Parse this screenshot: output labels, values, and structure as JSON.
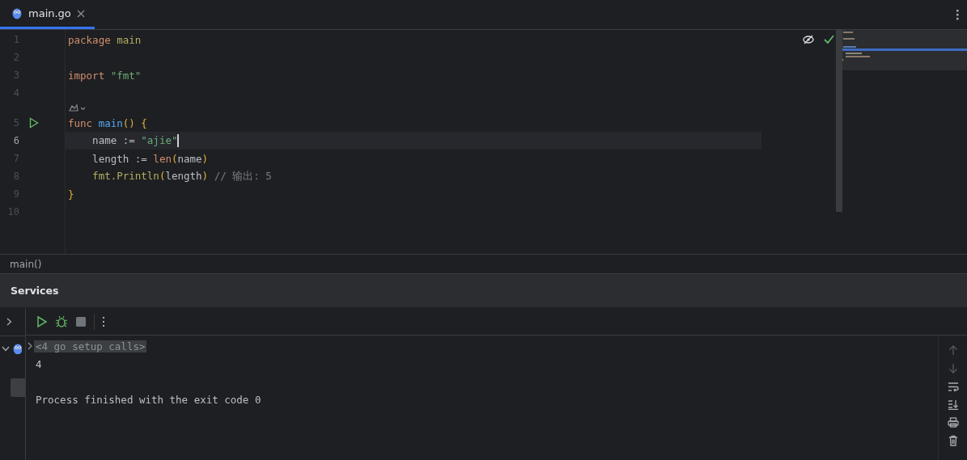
{
  "tabs": [
    {
      "label": "main.go",
      "selected": true
    }
  ],
  "editor": {
    "lines": [
      {
        "number": "1",
        "current": false,
        "tokens": [
          {
            "text": "package",
            "kind": "keyword"
          },
          {
            "text": " main",
            "kind": "ident"
          }
        ]
      },
      {
        "number": "2",
        "current": false
      },
      {
        "number": "3",
        "current": false,
        "tokens": [
          {
            "text": "import",
            "kind": "keyword"
          },
          {
            "text": " \"fmt\"",
            "kind": "string"
          }
        ]
      },
      {
        "number": "4",
        "current": false
      },
      {
        "number": "5",
        "current": false,
        "runnable": true,
        "hint_above": true,
        "tokens": [
          {
            "text": "func ",
            "kind": "keyword"
          },
          {
            "text": "main",
            "kind": "func"
          },
          {
            "text": "() {",
            "kind": "brace"
          }
        ]
      },
      {
        "number": "6",
        "current": true,
        "tokens": [
          {
            "text": "    name := ",
            "kind": "plain"
          },
          {
            "text": "\"ajie\"",
            "kind": "string"
          }
        ]
      },
      {
        "number": "7",
        "current": false,
        "tokens": [
          {
            "text": "    length := ",
            "kind": "plain"
          },
          {
            "text": "len",
            "kind": "builtin"
          },
          {
            "text": "(",
            "kind": "brace"
          },
          {
            "text": "name",
            "kind": "plain"
          },
          {
            "text": ")",
            "kind": "brace"
          }
        ]
      },
      {
        "number": "8",
        "current": false,
        "tokens": [
          {
            "text": "    fmt.Println",
            "kind": "call"
          },
          {
            "text": "(",
            "kind": "brace"
          },
          {
            "text": "length",
            "kind": "plain"
          },
          {
            "text": ")",
            "kind": "brace"
          },
          {
            "text": " // 输出: 5",
            "kind": "comment"
          }
        ]
      },
      {
        "number": "9",
        "current": false,
        "tokens": [
          {
            "text": "}",
            "kind": "brace"
          }
        ]
      },
      {
        "number": "10",
        "current": false
      }
    ]
  },
  "breadcrumb": "main()",
  "services": {
    "title": "Services",
    "console": [
      {
        "text": "<4 go setup calls>",
        "kind": "folded"
      },
      {
        "text": "4",
        "kind": "output"
      },
      {
        "text": "Process finished with the exit code 0",
        "kind": "status"
      }
    ]
  }
}
